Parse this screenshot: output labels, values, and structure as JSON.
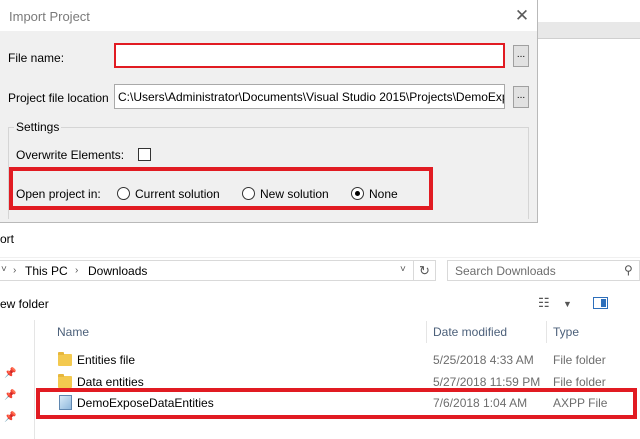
{
  "dialog": {
    "title": "Import Project",
    "close_glyph": "✕",
    "file_name_label": "File name:",
    "file_name_value": "",
    "browse_label": "...",
    "project_location_label": "Project file location",
    "project_location_value": "C:\\Users\\Administrator\\Documents\\Visual Studio 2015\\Projects\\DemoExp",
    "settings_caption": "Settings",
    "overwrite_label": "Overwrite Elements:",
    "open_project_label": "Open project in:",
    "radio_options": [
      "Current solution",
      "New solution",
      "None"
    ],
    "selected_option": "None"
  },
  "explorer": {
    "title_fragment": "ort",
    "breadcrumb": [
      "This PC",
      "Downloads"
    ],
    "search_placeholder": "Search Downloads",
    "new_folder_fragment": "ew folder",
    "columns": [
      "Name",
      "Date modified",
      "Type"
    ],
    "files": [
      {
        "name": "Entities file",
        "date": "5/25/2018 4:33 AM",
        "type": "File folder",
        "icon": "folder-icon"
      },
      {
        "name": "Data entities",
        "date": "5/27/2018 11:59 PM",
        "type": "File folder",
        "icon": "folder-icon"
      },
      {
        "name": "DemoExposeDataEntities",
        "date": "7/6/2018 1:04 AM",
        "type": "AXPP File",
        "icon": "axpp-file-icon"
      }
    ]
  },
  "colors": {
    "highlight_red": "#e11b22",
    "dialog_bg": "#f0f0f0",
    "column_header": "#4c607a"
  }
}
